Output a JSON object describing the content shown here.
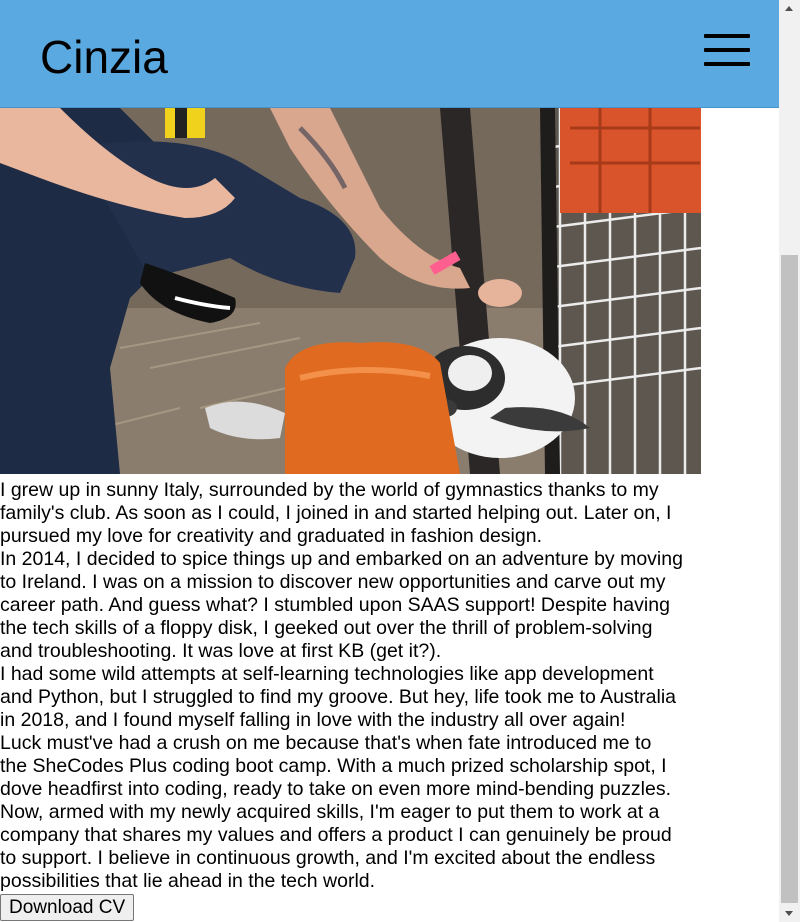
{
  "header": {
    "title": "Cinzia",
    "menu_icon": "hamburger-menu-icon",
    "background_color": "#5aa9e0"
  },
  "photo": {
    "subject": "person kneeling beside a black-and-white rabbit in a wire pen"
  },
  "bio": {
    "lines": [
      "I grew up in sunny Italy, surrounded by the world of gymnastics thanks to my",
      "family's club. As soon as I could, I joined in and started helping out. Later on, I",
      "pursued my love for creativity and graduated in fashion design.",
      "In 2014, I decided to spice things up and embarked on an adventure by moving",
      "to Ireland. I was on a mission to discover new opportunities and carve out my",
      "career path. And guess what? I stumbled upon SAAS support! Despite having",
      "the tech skills of a floppy disk, I geeked out over the thrill of problem-solving",
      "and troubleshooting. It was love at first KB (get it?).",
      "I had some wild attempts at self-learning technologies like app development",
      "and Python, but I struggled to find my groove. But hey, life took me to Australia",
      "in 2018, and I found myself falling in love with the industry all over again!",
      "Luck must've had a crush on me because that's when fate introduced me to",
      "the SheCodes Plus coding boot camp. With a much prized scholarship spot, I",
      "dove headfirst into coding, ready to take on even more mind-bending puzzles.",
      "Now, armed with my newly acquired skills, I'm eager to put them to work at a",
      "company that shares my values and offers a product I can genuinely be proud",
      "to support. I believe in continuous growth, and I'm excited about the endless",
      "possibilities that lie ahead in the tech world."
    ]
  },
  "download_button": {
    "label": "Download CV"
  }
}
